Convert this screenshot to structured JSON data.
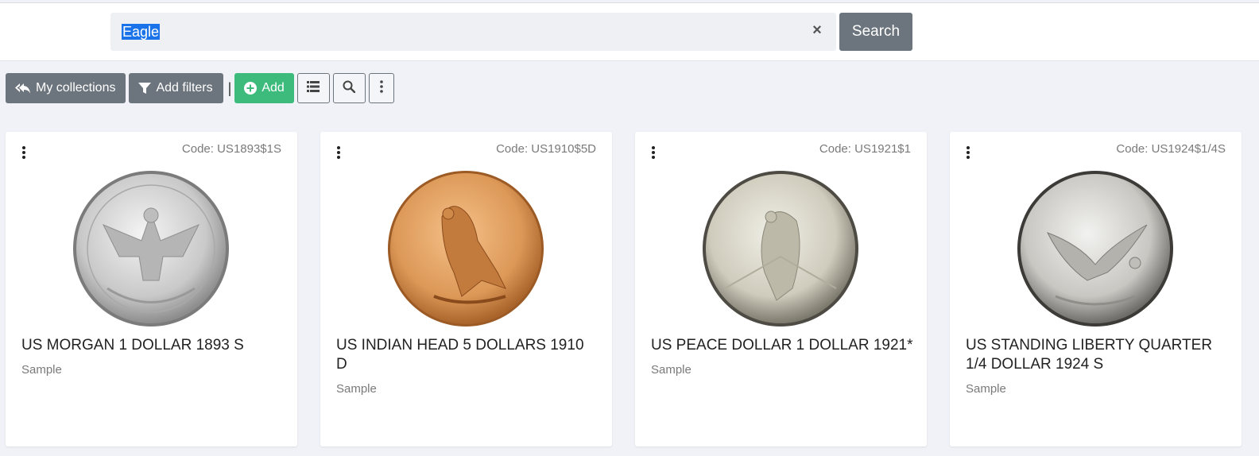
{
  "search": {
    "value": "Eagle",
    "clear_glyph": "×",
    "button_label": "Search"
  },
  "toolbar": {
    "collections_label": "My collections",
    "filters_label": "Add filters",
    "separator": "|",
    "add_label": "Add"
  },
  "colors": {
    "accent_green": "#3cbb7c",
    "button_gray": "#6c757d",
    "selection_blue": "#1a73e8"
  },
  "cards": [
    {
      "code": "Code: US1893$1S",
      "title": "US MORGAN 1 DOLLAR 1893 S",
      "subtitle": "Sample",
      "coin": "silver-morgan-eagle-coin"
    },
    {
      "code": "Code: US1910$5D",
      "title": "US INDIAN HEAD 5 DOLLARS 1910 D",
      "subtitle": "Sample",
      "coin": "gold-indian-head-eagle-coin"
    },
    {
      "code": "Code: US1921$1",
      "title": "US PEACE DOLLAR 1 DOLLAR 1921*",
      "subtitle": "Sample",
      "coin": "silver-peace-dollar-eagle-coin"
    },
    {
      "code": "Code: US1924$1/4S",
      "title": "US STANDING LIBERTY QUARTER 1/4 DOLLAR 1924 S",
      "subtitle": "Sample",
      "coin": "standing-liberty-quarter-eagle-coin"
    }
  ]
}
